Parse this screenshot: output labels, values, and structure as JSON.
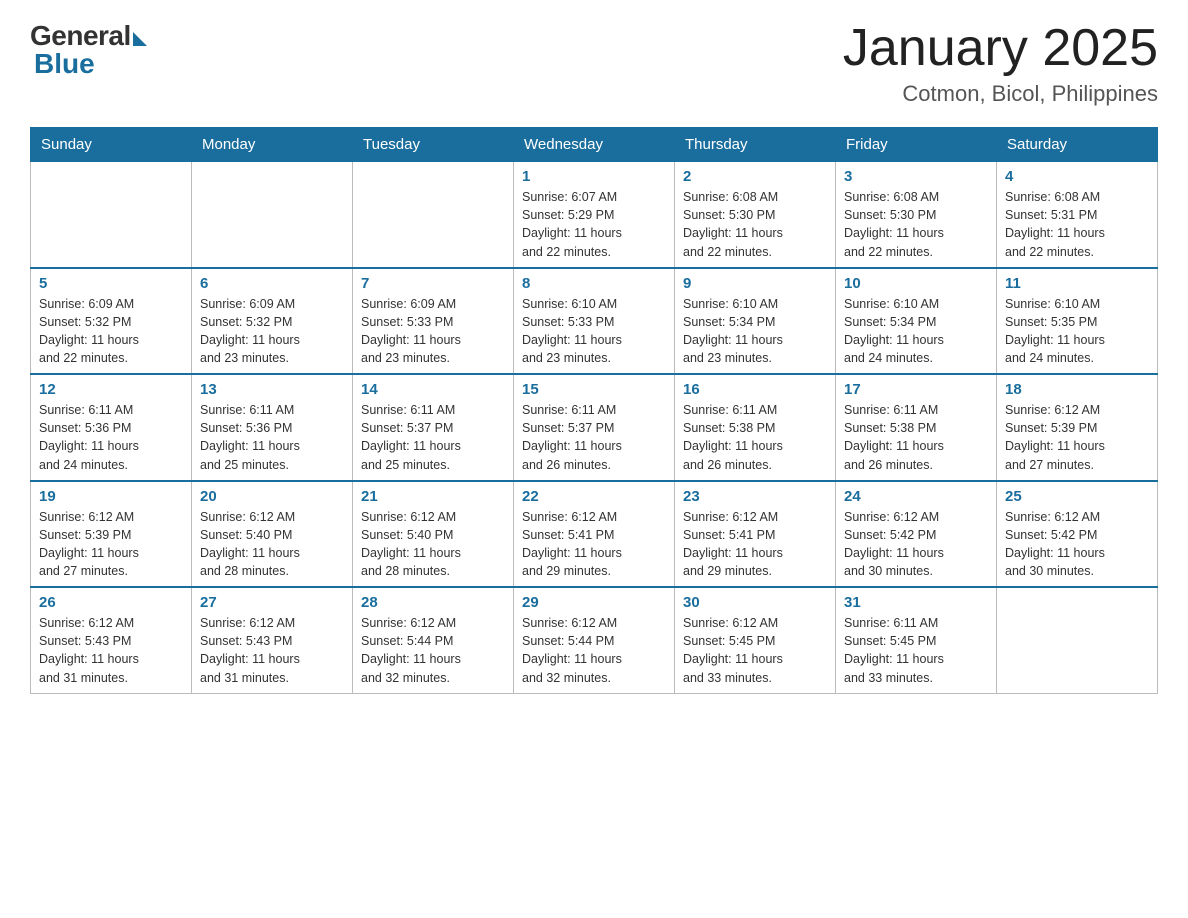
{
  "header": {
    "logo_general": "General",
    "logo_blue": "Blue",
    "month_year": "January 2025",
    "location": "Cotmon, Bicol, Philippines"
  },
  "calendar": {
    "days_of_week": [
      "Sunday",
      "Monday",
      "Tuesday",
      "Wednesday",
      "Thursday",
      "Friday",
      "Saturday"
    ],
    "weeks": [
      [
        {
          "day": "",
          "info": ""
        },
        {
          "day": "",
          "info": ""
        },
        {
          "day": "",
          "info": ""
        },
        {
          "day": "1",
          "info": "Sunrise: 6:07 AM\nSunset: 5:29 PM\nDaylight: 11 hours\nand 22 minutes."
        },
        {
          "day": "2",
          "info": "Sunrise: 6:08 AM\nSunset: 5:30 PM\nDaylight: 11 hours\nand 22 minutes."
        },
        {
          "day": "3",
          "info": "Sunrise: 6:08 AM\nSunset: 5:30 PM\nDaylight: 11 hours\nand 22 minutes."
        },
        {
          "day": "4",
          "info": "Sunrise: 6:08 AM\nSunset: 5:31 PM\nDaylight: 11 hours\nand 22 minutes."
        }
      ],
      [
        {
          "day": "5",
          "info": "Sunrise: 6:09 AM\nSunset: 5:32 PM\nDaylight: 11 hours\nand 22 minutes."
        },
        {
          "day": "6",
          "info": "Sunrise: 6:09 AM\nSunset: 5:32 PM\nDaylight: 11 hours\nand 23 minutes."
        },
        {
          "day": "7",
          "info": "Sunrise: 6:09 AM\nSunset: 5:33 PM\nDaylight: 11 hours\nand 23 minutes."
        },
        {
          "day": "8",
          "info": "Sunrise: 6:10 AM\nSunset: 5:33 PM\nDaylight: 11 hours\nand 23 minutes."
        },
        {
          "day": "9",
          "info": "Sunrise: 6:10 AM\nSunset: 5:34 PM\nDaylight: 11 hours\nand 23 minutes."
        },
        {
          "day": "10",
          "info": "Sunrise: 6:10 AM\nSunset: 5:34 PM\nDaylight: 11 hours\nand 24 minutes."
        },
        {
          "day": "11",
          "info": "Sunrise: 6:10 AM\nSunset: 5:35 PM\nDaylight: 11 hours\nand 24 minutes."
        }
      ],
      [
        {
          "day": "12",
          "info": "Sunrise: 6:11 AM\nSunset: 5:36 PM\nDaylight: 11 hours\nand 24 minutes."
        },
        {
          "day": "13",
          "info": "Sunrise: 6:11 AM\nSunset: 5:36 PM\nDaylight: 11 hours\nand 25 minutes."
        },
        {
          "day": "14",
          "info": "Sunrise: 6:11 AM\nSunset: 5:37 PM\nDaylight: 11 hours\nand 25 minutes."
        },
        {
          "day": "15",
          "info": "Sunrise: 6:11 AM\nSunset: 5:37 PM\nDaylight: 11 hours\nand 26 minutes."
        },
        {
          "day": "16",
          "info": "Sunrise: 6:11 AM\nSunset: 5:38 PM\nDaylight: 11 hours\nand 26 minutes."
        },
        {
          "day": "17",
          "info": "Sunrise: 6:11 AM\nSunset: 5:38 PM\nDaylight: 11 hours\nand 26 minutes."
        },
        {
          "day": "18",
          "info": "Sunrise: 6:12 AM\nSunset: 5:39 PM\nDaylight: 11 hours\nand 27 minutes."
        }
      ],
      [
        {
          "day": "19",
          "info": "Sunrise: 6:12 AM\nSunset: 5:39 PM\nDaylight: 11 hours\nand 27 minutes."
        },
        {
          "day": "20",
          "info": "Sunrise: 6:12 AM\nSunset: 5:40 PM\nDaylight: 11 hours\nand 28 minutes."
        },
        {
          "day": "21",
          "info": "Sunrise: 6:12 AM\nSunset: 5:40 PM\nDaylight: 11 hours\nand 28 minutes."
        },
        {
          "day": "22",
          "info": "Sunrise: 6:12 AM\nSunset: 5:41 PM\nDaylight: 11 hours\nand 29 minutes."
        },
        {
          "day": "23",
          "info": "Sunrise: 6:12 AM\nSunset: 5:41 PM\nDaylight: 11 hours\nand 29 minutes."
        },
        {
          "day": "24",
          "info": "Sunrise: 6:12 AM\nSunset: 5:42 PM\nDaylight: 11 hours\nand 30 minutes."
        },
        {
          "day": "25",
          "info": "Sunrise: 6:12 AM\nSunset: 5:42 PM\nDaylight: 11 hours\nand 30 minutes."
        }
      ],
      [
        {
          "day": "26",
          "info": "Sunrise: 6:12 AM\nSunset: 5:43 PM\nDaylight: 11 hours\nand 31 minutes."
        },
        {
          "day": "27",
          "info": "Sunrise: 6:12 AM\nSunset: 5:43 PM\nDaylight: 11 hours\nand 31 minutes."
        },
        {
          "day": "28",
          "info": "Sunrise: 6:12 AM\nSunset: 5:44 PM\nDaylight: 11 hours\nand 32 minutes."
        },
        {
          "day": "29",
          "info": "Sunrise: 6:12 AM\nSunset: 5:44 PM\nDaylight: 11 hours\nand 32 minutes."
        },
        {
          "day": "30",
          "info": "Sunrise: 6:12 AM\nSunset: 5:45 PM\nDaylight: 11 hours\nand 33 minutes."
        },
        {
          "day": "31",
          "info": "Sunrise: 6:11 AM\nSunset: 5:45 PM\nDaylight: 11 hours\nand 33 minutes."
        },
        {
          "day": "",
          "info": ""
        }
      ]
    ]
  }
}
